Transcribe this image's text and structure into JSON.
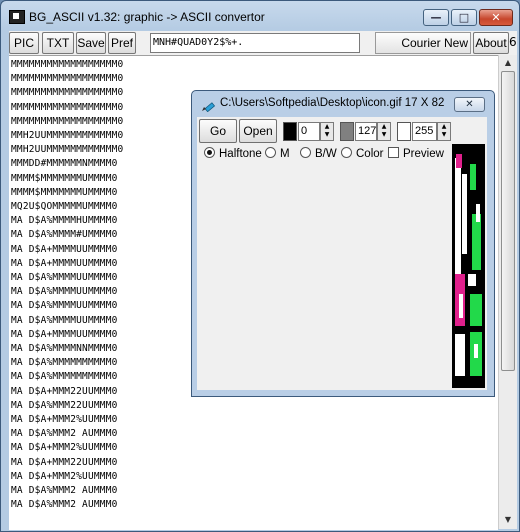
{
  "window": {
    "title": "BG_ASCII v1.32: graphic -> ASCII convertor"
  },
  "toolbar": {
    "pic_label": "PIC",
    "txt_label": "TXT",
    "save_label": "Save",
    "pref_label": "Pref",
    "ascii_chars": "MNH#QUAD0Y2$%+.",
    "font_name": "Courier New",
    "about_label": "About",
    "edge_text": "6"
  },
  "ascii_lines": [
    "MMMMMMMMMMMMMMMMMM0",
    "MMMMMMMMMMMMMMMMMM0",
    "MMMMMMMMMMMMMMMMMM0",
    "MMMMMMMMMMMMMMMMMM0",
    "MMMMMMMMMMMMMMMMMM0",
    "MMH2UUMMMMMMMMMMMM0",
    "MMH2UUMMMMMMMMMMMM0",
    "MMMDD#MMMMMMNMMMM0",
    "MMMM$MMMMMMMUMMMM0",
    "MMMM$MMMMMMMUMMMM0",
    "MQ2U$QOMMMMMUMMMM0",
    "MA D$A%MMMMHUMMMM0",
    "MA D$A%MMMM#UMMMM0",
    "MA D$A+MMMMUUMMMM0",
    "MA D$A+MMMMUUMMMM0",
    "MA D$A%MMMMUUMMMM0",
    "MA D$A%MMMMUUMMMM0",
    "MA D$A%MMMMUUMMMM0",
    "MA D$A%MMMMUUMMMM0",
    "MA D$A+MMMMUUMMMM0",
    "MA D$A%MMMMNNMMMM0",
    "MA D$A%MMMMMMMMMM0",
    "MA D$A%MMMMMMMMMM0",
    "MA D$A+MMM22UUMMM0",
    "MA D$A%MMM22UUMMM0",
    "MA D$A+MMM2%UUMMM0",
    "MA D$A%MMM2 AUMMM0",
    "MA D$A+MMM2%UUMMM0",
    "MA D$A+MMM22UUMMM0",
    "MA D$A+MMM2%UUMMM0",
    "MA D$A%MMM2 AUMMM0",
    "MA D$A%MMM2 AUMMM0"
  ],
  "image_window": {
    "title": "C:\\Users\\Softpedia\\Desktop\\icon.gif 17 X 82",
    "go_label": "Go",
    "open_label": "Open",
    "black_value": "0",
    "gray_value": "127",
    "white_value": "255",
    "modes": [
      "Halftone",
      "M",
      "B/W",
      "Color"
    ],
    "selected_mode": "Halftone",
    "preview_label": "Preview",
    "preview_checked": false
  },
  "colors": {
    "title_bar": "#b4cbe3",
    "close_button": "#c7462c",
    "preview_green": "#22d94a",
    "preview_magenta": "#e0208c"
  }
}
